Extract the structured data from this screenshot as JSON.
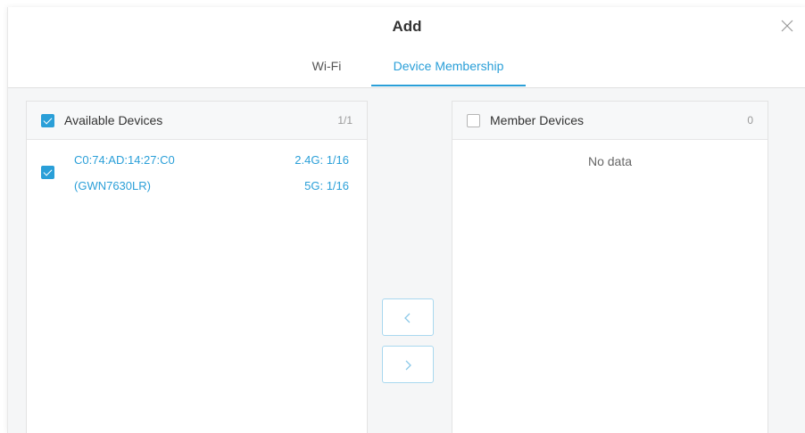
{
  "dialog": {
    "title": "Add"
  },
  "tabs": [
    {
      "label": "Wi-Fi",
      "active": false
    },
    {
      "label": "Device Membership",
      "active": true
    }
  ],
  "available_panel": {
    "title": "Available Devices",
    "count": "1/1",
    "select_all_checked": true,
    "items": [
      {
        "mac": "C0:74:AD:14:27:C0",
        "model": "(GWN7630LR)",
        "band_24g": "2.4G: 1/16",
        "band_5g": "5G: 1/16",
        "checked": true
      }
    ]
  },
  "member_panel": {
    "title": "Member Devices",
    "count": "0",
    "select_all_checked": false,
    "empty_text": "No data"
  },
  "transfer": {
    "move_left_icon": "chevron-left-icon",
    "move_right_icon": "chevron-right-icon"
  },
  "colors": {
    "accent": "#2a9fd8",
    "text": "#333333",
    "muted": "#999999",
    "background": "#f5f6f7"
  }
}
